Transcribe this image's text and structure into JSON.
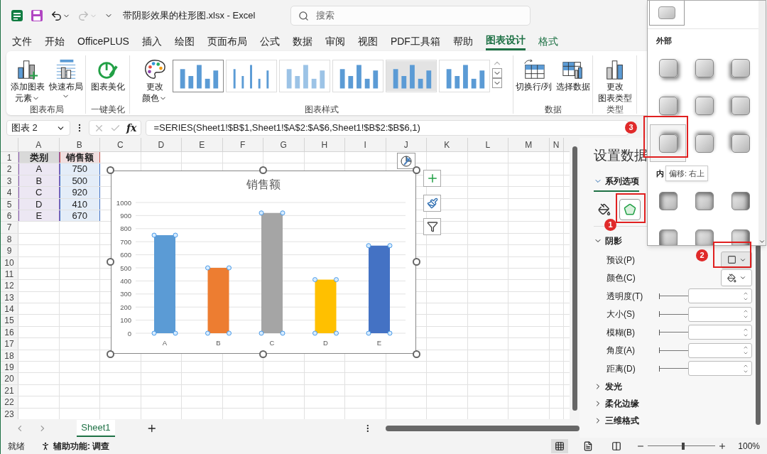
{
  "title_bar": {
    "title": "带阴影效果的柱形图.xlsx  -  Excel",
    "redo": {
      "disabled": true
    },
    "search": {
      "placeholder": "搜索"
    }
  },
  "menu_tabs": [
    {
      "label": "文件",
      "selected": false,
      "contextual": false
    },
    {
      "label": "开始",
      "selected": false,
      "contextual": false
    },
    {
      "label": "OfficePLUS",
      "selected": false,
      "contextual": false
    },
    {
      "label": "插入",
      "selected": false,
      "contextual": false
    },
    {
      "label": "绘图",
      "selected": false,
      "contextual": false
    },
    {
      "label": "页面布局",
      "selected": false,
      "contextual": false
    },
    {
      "label": "公式",
      "selected": false,
      "contextual": false
    },
    {
      "label": "数据",
      "selected": false,
      "contextual": false
    },
    {
      "label": "审阅",
      "selected": false,
      "contextual": false
    },
    {
      "label": "视图",
      "selected": false,
      "contextual": false
    },
    {
      "label": "PDF工具箱",
      "selected": false,
      "contextual": false
    },
    {
      "label": "帮助",
      "selected": false,
      "contextual": false
    },
    {
      "label": "图表设计",
      "selected": true,
      "contextual": true
    },
    {
      "label": "格式",
      "selected": false,
      "contextual": true
    }
  ],
  "ribbon": {
    "groups": [
      {
        "label": "图表布局",
        "buttons": [
          {
            "lines": [
              "添加图表",
              "元素"
            ],
            "dropdown": true
          },
          {
            "lines": [
              "快速布局"
            ],
            "dropdown": true
          }
        ]
      },
      {
        "label": "一键美化",
        "buttons": [
          {
            "lines": [
              "图表美化"
            ],
            "dropdown": false
          }
        ]
      },
      {
        "label": "图表样式",
        "buttons": [
          {
            "lines": [
              "更改",
              "颜色"
            ],
            "dropdown": true
          }
        ],
        "styles": [
          {
            "selected": true
          },
          {
            "selected": false
          },
          {
            "selected": false
          },
          {
            "selected": false
          },
          {
            "selected": false
          },
          {
            "selected": false
          }
        ]
      },
      {
        "label": "数据",
        "buttons": [
          {
            "lines": [
              "切换行/列"
            ],
            "dropdown": false
          },
          {
            "lines": [
              "选择数据"
            ],
            "dropdown": false
          }
        ]
      },
      {
        "label": "类型",
        "buttons": [
          {
            "lines": [
              "更改",
              "图表类型"
            ],
            "dropdown": false
          }
        ]
      }
    ]
  },
  "formula_bar": {
    "name_box": "图表 2",
    "fx": "fx",
    "formula": "=SERIES(Sheet1!$B$1,Sheet1!$A$2:$A$6,Sheet1!$B$2:$B$6,1)"
  },
  "sheet": {
    "columns": [
      "A",
      "B",
      "C",
      "D",
      "E",
      "F",
      "G",
      "H",
      "I",
      "J",
      "K",
      "L",
      "M",
      "N"
    ],
    "row_numbers": [
      "1",
      "2",
      "3",
      "4",
      "5",
      "6",
      "7",
      "8",
      "9",
      "10",
      "11",
      "12",
      "13",
      "14",
      "15",
      "16",
      "17",
      "18",
      "19",
      "20",
      "21",
      "22",
      "23"
    ],
    "cells": [
      [
        "类别",
        "销售额"
      ],
      [
        "A",
        "750"
      ],
      [
        "B",
        "500"
      ],
      [
        "C",
        "920"
      ],
      [
        "D",
        "410"
      ],
      [
        "E",
        "670"
      ]
    ]
  },
  "chart": {
    "chart_data": {
      "type": "bar",
      "title": "销售额",
      "categories": [
        "A",
        "B",
        "C",
        "D",
        "E"
      ],
      "stacked": true,
      "grid": true,
      "series": [
        {
          "color": "#5b9bd5",
          "values": [
            750,
            null,
            null,
            null,
            null
          ]
        },
        {
          "color": "#ed7d31",
          "values": [
            null,
            500,
            null,
            null,
            null
          ]
        },
        {
          "color": "#a5a5a5",
          "values": [
            null,
            null,
            920,
            null,
            null
          ]
        },
        {
          "color": "#ffc000",
          "values": [
            null,
            null,
            null,
            410,
            null
          ]
        },
        {
          "color": "#4472c4",
          "values": [
            null,
            null,
            null,
            null,
            670
          ]
        }
      ],
      "ylim": [
        0,
        1000
      ],
      "yticks": [
        0,
        100,
        200,
        300,
        400,
        500,
        600,
        700,
        800,
        900,
        1000
      ]
    }
  },
  "format_panel": {
    "title": "设置数据",
    "tabs": [
      {
        "label": "系列选项",
        "selected": true
      }
    ],
    "icon_tabs": [
      {
        "selected": false
      },
      {
        "selected": true
      }
    ],
    "sections": [
      {
        "label": "阴影",
        "expanded": true,
        "rows": [
          {
            "kind": "preset",
            "label": "预设(P)"
          },
          {
            "kind": "color",
            "label": "颜色(C)"
          },
          {
            "kind": "spin",
            "label": "透明度(T)"
          },
          {
            "kind": "spin",
            "label": "大小(S)"
          },
          {
            "kind": "spin",
            "label": "模糊(B)"
          },
          {
            "kind": "spin",
            "label": "角度(A)"
          },
          {
            "kind": "spin",
            "label": "距离(D)"
          }
        ]
      },
      {
        "label": "发光",
        "expanded": false
      },
      {
        "label": "柔化边缘",
        "expanded": false
      },
      {
        "label": "三维格式",
        "expanded": false
      }
    ]
  },
  "shadow_gallery": {
    "sections": [
      {
        "heading": "外部",
        "kind": "outer",
        "presets": [
          {
            "selected": false
          },
          {
            "selected": false
          },
          {
            "selected": false
          },
          {
            "selected": false
          },
          {
            "selected": false
          },
          {
            "selected": false
          },
          {
            "selected": true
          },
          {
            "selected": false
          },
          {
            "selected": false
          }
        ]
      },
      {
        "heading": "内",
        "kind": "inner",
        "presets": [
          {
            "selected": false
          },
          {
            "selected": false
          },
          {
            "selected": false
          },
          {
            "selected": false
          },
          {
            "selected": false
          },
          {
            "selected": false
          }
        ]
      }
    ],
    "tooltip": "偏移: 右上"
  },
  "annotations": [
    {
      "label": "1"
    },
    {
      "label": "2"
    },
    {
      "label": "3"
    }
  ],
  "sheet_tabs": [
    {
      "label": "Sheet1",
      "selected": true
    }
  ],
  "status_bar": {
    "ready": "就绪",
    "accessibility": "辅助功能: 调查",
    "views": [
      {
        "selected": true
      },
      {
        "selected": false
      },
      {
        "selected": false
      }
    ],
    "zoom": {
      "level": 0.52,
      "reading": "100%"
    }
  }
}
